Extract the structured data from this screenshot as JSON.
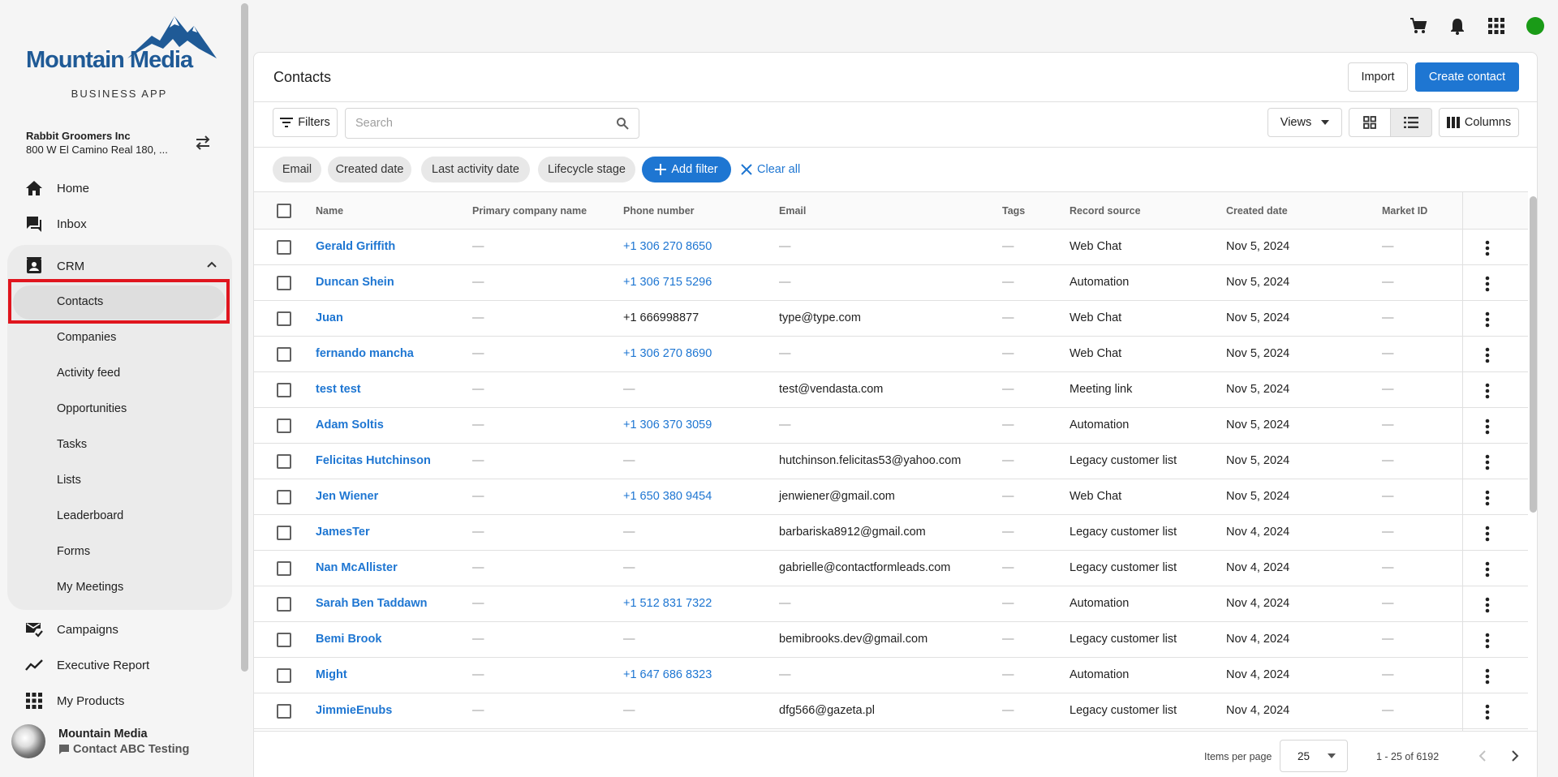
{
  "brand": {
    "name": "Mountain Media",
    "subtitle": "BUSINESS APP",
    "logo_color": "#1f5a96"
  },
  "account": {
    "name": "Rabbit Groomers Inc",
    "address": "800 W El Camino Real 180, ..."
  },
  "sidebar": {
    "items": [
      {
        "label": "Home",
        "icon": "home-icon"
      },
      {
        "label": "Inbox",
        "icon": "inbox-icon"
      },
      {
        "label": "CRM",
        "icon": "contacts-book-icon"
      },
      {
        "label": "Campaigns",
        "icon": "mail-check-icon"
      },
      {
        "label": "Executive Report",
        "icon": "trend-line-icon"
      },
      {
        "label": "My Products",
        "icon": "apps-grid-icon"
      }
    ],
    "crm_subitems": [
      "Contacts",
      "Companies",
      "Activity feed",
      "Opportunities",
      "Tasks",
      "Lists",
      "Leaderboard",
      "Forms",
      "My Meetings"
    ],
    "active_subitem": "Contacts"
  },
  "user": {
    "name": "Mountain Media",
    "context": "Contact ABC Testing"
  },
  "topbar": {
    "icons": [
      "cart-icon",
      "bell-icon",
      "apps-grid-icon"
    ],
    "status_color": "#1a9b17"
  },
  "page": {
    "title": "Contacts",
    "import_label": "Import",
    "create_label": "Create contact",
    "filters_label": "Filters",
    "search_placeholder": "Search",
    "views_label": "Views",
    "columns_label": "Columns",
    "accent_color": "#1e76d2"
  },
  "filter_chips": [
    "Email",
    "Created date",
    "Last activity date",
    "Lifecycle stage"
  ],
  "add_filter_label": "Add filter",
  "clear_all_label": "Clear all",
  "table": {
    "columns": [
      "Name",
      "Primary company name",
      "Phone number",
      "Email",
      "Tags",
      "Record source",
      "Created date",
      "Market ID"
    ],
    "rows": [
      {
        "name": "Gerald Griffith",
        "company": "—",
        "phone": "+1 306 270 8650",
        "email": "—",
        "tags": "—",
        "source": "Web Chat",
        "created": "Nov 5, 2024",
        "market": "—"
      },
      {
        "name": "Duncan Shein",
        "company": "—",
        "phone": "+1 306 715 5296",
        "email": "—",
        "tags": "—",
        "source": "Automation",
        "created": "Nov 5, 2024",
        "market": "—"
      },
      {
        "name": "Juan",
        "company": "—",
        "phone": "+1 666998877",
        "email": "type@type.com",
        "tags": "—",
        "source": "Web Chat",
        "created": "Nov 5, 2024",
        "market": "—"
      },
      {
        "name": "fernando mancha",
        "company": "—",
        "phone": "+1 306 270 8690",
        "email": "—",
        "tags": "—",
        "source": "Web Chat",
        "created": "Nov 5, 2024",
        "market": "—"
      },
      {
        "name": "test test",
        "company": "—",
        "phone": "—",
        "email": "test@vendasta.com",
        "tags": "—",
        "source": "Meeting link",
        "created": "Nov 5, 2024",
        "market": "—"
      },
      {
        "name": "Adam Soltis",
        "company": "—",
        "phone": "+1 306 370 3059",
        "email": "—",
        "tags": "—",
        "source": "Automation",
        "created": "Nov 5, 2024",
        "market": "—"
      },
      {
        "name": "Felicitas Hutchinson",
        "company": "—",
        "phone": "—",
        "email": "hutchinson.felicitas53@yahoo.com",
        "tags": "—",
        "source": "Legacy customer list",
        "created": "Nov 5, 2024",
        "market": "—"
      },
      {
        "name": "Jen Wiener",
        "company": "—",
        "phone": "+1 650 380 9454",
        "email": "jenwiener@gmail.com",
        "tags": "—",
        "source": "Web Chat",
        "created": "Nov 5, 2024",
        "market": "—"
      },
      {
        "name": "JamesTer",
        "company": "—",
        "phone": "—",
        "email": "barbariska8912@gmail.com",
        "tags": "—",
        "source": "Legacy customer list",
        "created": "Nov 4, 2024",
        "market": "—"
      },
      {
        "name": "Nan McAllister",
        "company": "—",
        "phone": "—",
        "email": "gabrielle@contactformleads.com",
        "tags": "—",
        "source": "Legacy customer list",
        "created": "Nov 4, 2024",
        "market": "—"
      },
      {
        "name": "Sarah Ben Taddawn",
        "company": "—",
        "phone": "+1 512 831 7322",
        "email": "—",
        "tags": "—",
        "source": "Automation",
        "created": "Nov 4, 2024",
        "market": "—"
      },
      {
        "name": "Bemi Brook",
        "company": "—",
        "phone": "—",
        "email": "bemibrooks.dev@gmail.com",
        "tags": "—",
        "source": "Legacy customer list",
        "created": "Nov 4, 2024",
        "market": "—"
      },
      {
        "name": "Might",
        "company": "—",
        "phone": "+1 647 686 8323",
        "email": "—",
        "tags": "—",
        "source": "Automation",
        "created": "Nov 4, 2024",
        "market": "—"
      },
      {
        "name": "JimmieEnubs",
        "company": "—",
        "phone": "—",
        "email": "dfg566@gazeta.pl",
        "tags": "—",
        "source": "Legacy customer list",
        "created": "Nov 4, 2024",
        "market": "—"
      }
    ]
  },
  "pagination": {
    "items_per_page_label": "Items per page",
    "items_per_page": "25",
    "range": "1 - 25 of 6192"
  }
}
